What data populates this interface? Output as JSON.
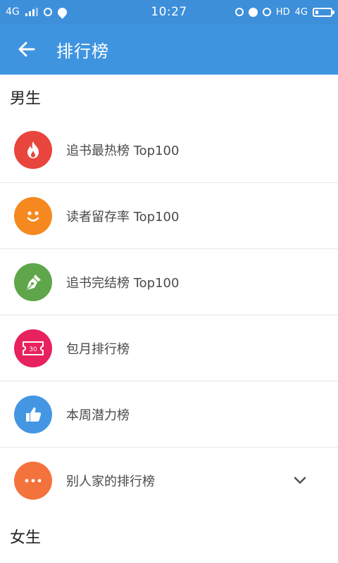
{
  "status_bar": {
    "network": "4G",
    "time": "10:27",
    "right_text_hd": "HD",
    "right_text_4g": "4G"
  },
  "app_bar": {
    "title": "排行榜",
    "back_icon": "arrow-left-icon"
  },
  "sections": [
    {
      "title": "男生",
      "items": [
        {
          "label": "追书最热榜 Top100",
          "icon": "flame-icon",
          "color": "#e8453c"
        },
        {
          "label": "读者留存率 Top100",
          "icon": "smile-icon",
          "color": "#f5891f"
        },
        {
          "label": "追书完结榜 Top100",
          "icon": "pen-nib-icon",
          "color": "#5fa64a"
        },
        {
          "label": "包月排行榜",
          "icon": "ticket-30-icon",
          "color": "#e8215f",
          "badge": "30"
        },
        {
          "label": "本周潜力榜",
          "icon": "thumbs-up-icon",
          "color": "#4496e3"
        },
        {
          "label": "别人家的排行榜",
          "icon": "more-dots-icon",
          "color": "#f4733c",
          "expand_icon": "chevron-down-icon"
        }
      ]
    },
    {
      "title": "女生",
      "items": []
    }
  ],
  "colors": {
    "status_bar": "#3d8fd9",
    "app_bar": "#3f94e0",
    "divider": "#e6e6e6",
    "label_text": "#4a4a4a",
    "section_text": "#222222"
  }
}
